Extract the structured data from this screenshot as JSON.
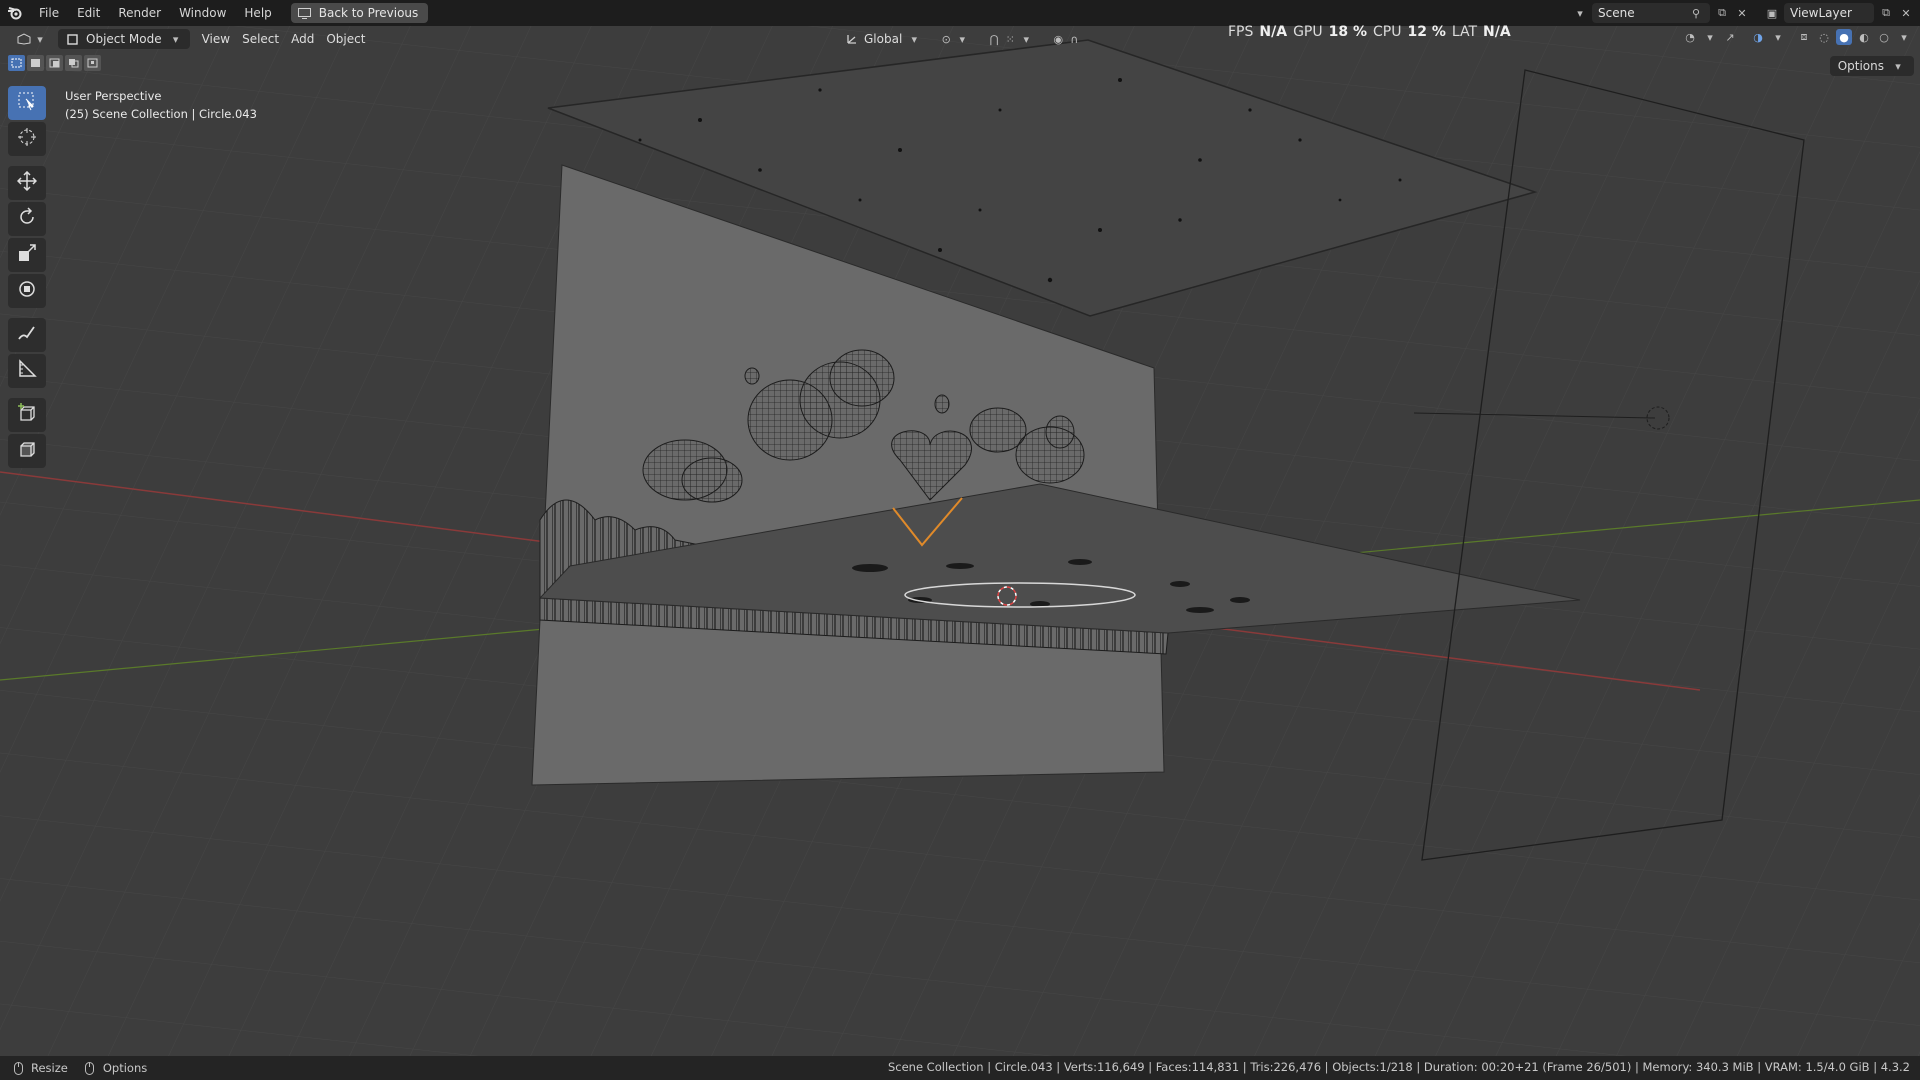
{
  "menu": {
    "file": "File",
    "edit": "Edit",
    "render": "Render",
    "window": "Window",
    "help": "Help",
    "back_button": "Back to Previous"
  },
  "top_right": {
    "scene": "Scene",
    "view_layer": "ViewLayer"
  },
  "header": {
    "mode": "Object Mode",
    "view": "View",
    "select": "Select",
    "add": "Add",
    "object": "Object",
    "orientation": "Global",
    "options": "Options"
  },
  "stats": {
    "fps_label": "FPS",
    "fps_value": "N/A",
    "gpu_label": "GPU",
    "gpu_value": "18 %",
    "cpu_label": "CPU",
    "cpu_value": "12 %",
    "lat_label": "LAT",
    "lat_value": "N/A"
  },
  "viewport": {
    "perspective": "User Perspective",
    "collection": "(25) Scene Collection | Circle.043"
  },
  "statusbar": {
    "resize": "Resize",
    "options": "Options",
    "info": "Scene Collection | Circle.043 | Verts:116,649 | Faces:114,831 | Tris:226,476 | Objects:1/218 | Duration: 00:20+21 (Frame 26/501) | Memory: 340.3 MiB | VRAM: 1.5/4.0 GiB | 4.3.2"
  },
  "colors": {
    "accent": "#4772b3",
    "viewport_bg": "#3d3d3d",
    "x_axis": "#8a3a3a",
    "y_axis": "#5a7a2a",
    "selection_outline": "#e08a2a"
  }
}
